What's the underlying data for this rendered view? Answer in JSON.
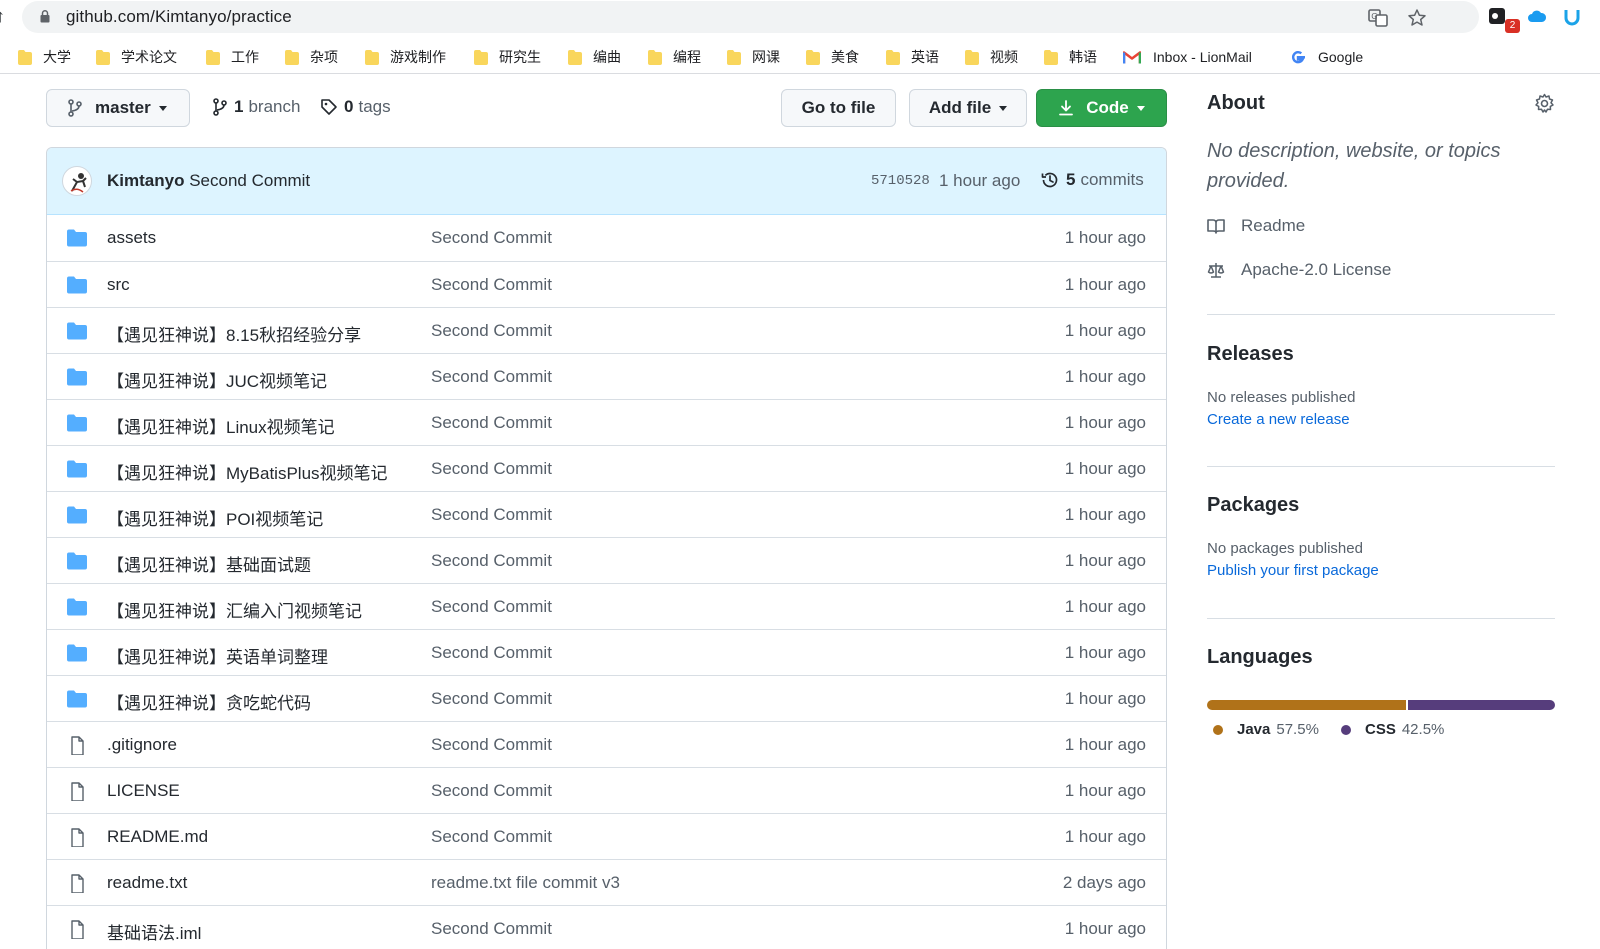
{
  "browser": {
    "url": "github.com/Kimtanyo/practice",
    "extension_badge": "2",
    "bookmarks": [
      {
        "label": "大学",
        "icon": "folder-icon"
      },
      {
        "label": "学术论文",
        "icon": "folder-icon"
      },
      {
        "label": "工作",
        "icon": "folder-icon"
      },
      {
        "label": "杂项",
        "icon": "folder-icon"
      },
      {
        "label": "游戏制作",
        "icon": "folder-icon"
      },
      {
        "label": "研究生",
        "icon": "folder-icon"
      },
      {
        "label": "编曲",
        "icon": "folder-icon"
      },
      {
        "label": "编程",
        "icon": "folder-icon"
      },
      {
        "label": "网课",
        "icon": "folder-icon"
      },
      {
        "label": "美食",
        "icon": "folder-icon"
      },
      {
        "label": "英语",
        "icon": "folder-icon"
      },
      {
        "label": "视频",
        "icon": "folder-icon"
      },
      {
        "label": "韩语",
        "icon": "folder-icon"
      },
      {
        "label": "Inbox - LionMail",
        "icon": "gmail-icon"
      },
      {
        "label": "Google",
        "icon": "google-icon"
      }
    ]
  },
  "repo": {
    "branch_button": "master",
    "branch_count": "1",
    "branch_label": "branch",
    "tag_count": "0",
    "tag_label": "tags",
    "go_to_file": "Go to file",
    "add_file": "Add file",
    "code": "Code"
  },
  "latest_commit": {
    "author": "Kimtanyo",
    "message": "Second Commit",
    "sha": "5710528",
    "time": "1 hour ago",
    "commit_count": "5",
    "commit_label": "commits"
  },
  "files": [
    {
      "type": "dir",
      "name": "assets",
      "message": "Second Commit",
      "time": "1 hour ago"
    },
    {
      "type": "dir",
      "name": "src",
      "message": "Second Commit",
      "time": "1 hour ago"
    },
    {
      "type": "dir",
      "name": "【遇见狂神说】8.15秋招经验分享",
      "message": "Second Commit",
      "time": "1 hour ago"
    },
    {
      "type": "dir",
      "name": "【遇见狂神说】JUC视频笔记",
      "message": "Second Commit",
      "time": "1 hour ago"
    },
    {
      "type": "dir",
      "name": "【遇见狂神说】Linux视频笔记",
      "message": "Second Commit",
      "time": "1 hour ago"
    },
    {
      "type": "dir",
      "name": "【遇见狂神说】MyBatisPlus视频笔记",
      "message": "Second Commit",
      "time": "1 hour ago"
    },
    {
      "type": "dir",
      "name": "【遇见狂神说】POI视频笔记",
      "message": "Second Commit",
      "time": "1 hour ago"
    },
    {
      "type": "dir",
      "name": "【遇见狂神说】基础面试题",
      "message": "Second Commit",
      "time": "1 hour ago"
    },
    {
      "type": "dir",
      "name": "【遇见狂神说】汇编入门视频笔记",
      "message": "Second Commit",
      "time": "1 hour ago"
    },
    {
      "type": "dir",
      "name": "【遇见狂神说】英语单词整理",
      "message": "Second Commit",
      "time": "1 hour ago"
    },
    {
      "type": "dir",
      "name": "【遇见狂神说】贪吃蛇代码",
      "message": "Second Commit",
      "time": "1 hour ago"
    },
    {
      "type": "file",
      "name": ".gitignore",
      "message": "Second Commit",
      "time": "1 hour ago"
    },
    {
      "type": "file",
      "name": "LICENSE",
      "message": "Second Commit",
      "time": "1 hour ago"
    },
    {
      "type": "file",
      "name": "README.md",
      "message": "Second Commit",
      "time": "1 hour ago"
    },
    {
      "type": "file",
      "name": "readme.txt",
      "message": "readme.txt file commit v3",
      "time": "2 days ago"
    },
    {
      "type": "file",
      "name": "基础语法.iml",
      "message": "Second Commit",
      "time": "1 hour ago"
    }
  ],
  "sidebar": {
    "about_title": "About",
    "about_description": "No description, website, or topics provided.",
    "readme": "Readme",
    "license": "Apache-2.0 License",
    "releases_title": "Releases",
    "releases_none": "No releases published",
    "releases_link": "Create a new release",
    "packages_title": "Packages",
    "packages_none": "No packages published",
    "packages_link": "Publish your first package",
    "languages_title": "Languages",
    "languages": [
      {
        "name": "Java",
        "percent_label": "57.5%",
        "percent": 57.5,
        "color": "#b07219"
      },
      {
        "name": "CSS",
        "percent_label": "42.5%",
        "percent": 42.5,
        "color": "#563d7c"
      }
    ]
  }
}
